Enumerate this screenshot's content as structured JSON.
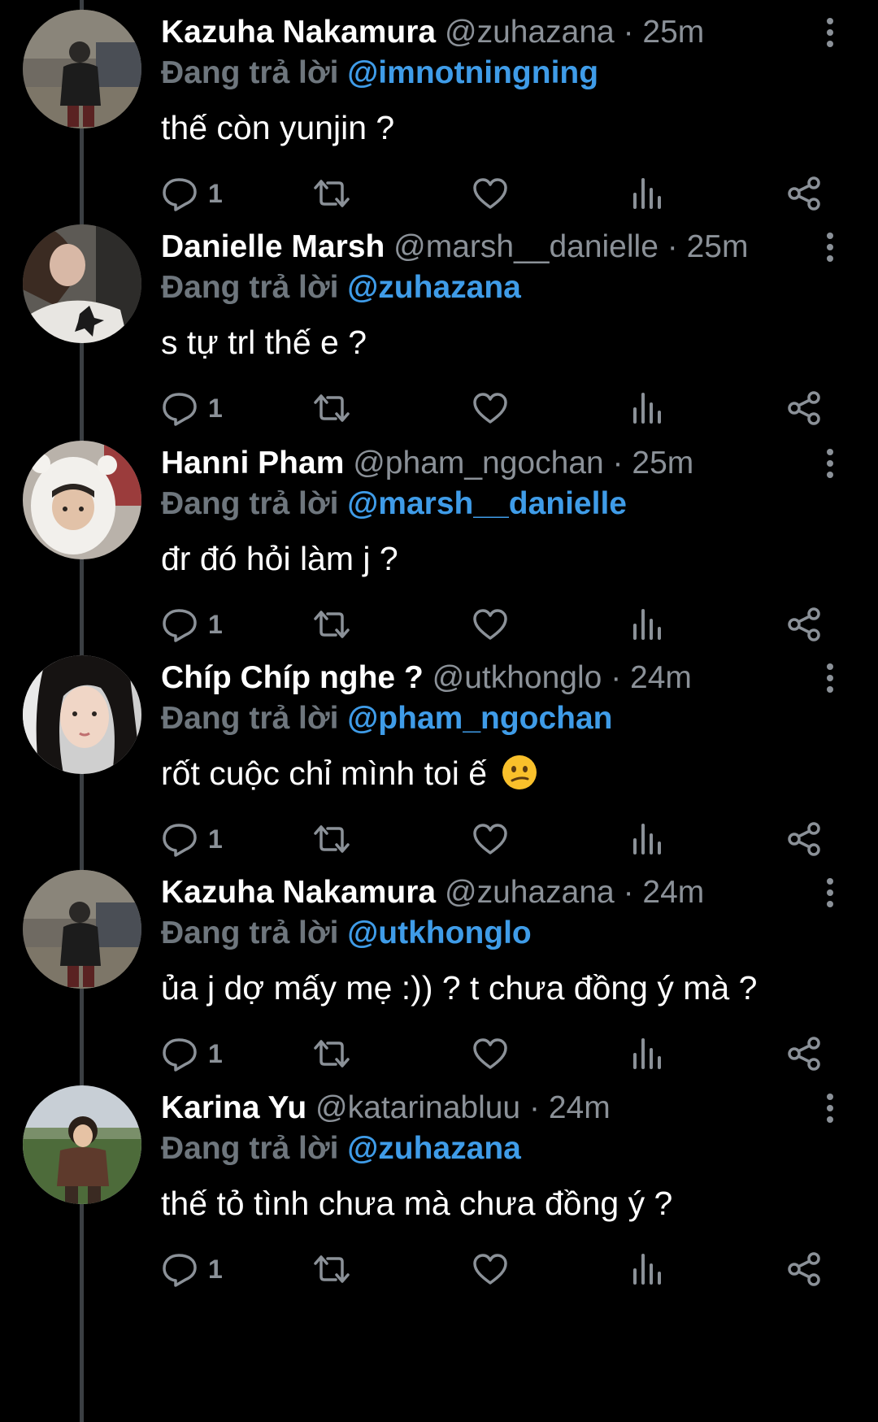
{
  "replying_label": "Đang trả lời",
  "colors": {
    "background": "#000000",
    "name": "#ffffff",
    "muted": "#8b9198",
    "mention": "#3f9ce8",
    "thread_line": "#3b3f43"
  },
  "icons": [
    "reply-icon",
    "retweet-icon",
    "like-icon",
    "views-icon",
    "share-icon",
    "more-icon"
  ],
  "tweets": [
    {
      "name": "Kazuha Nakamura",
      "handle": "@zuhazana",
      "sep": "·",
      "time": "25m",
      "mention": "@imnotningning",
      "text": "thế còn yunjin ?",
      "reply_count": "1"
    },
    {
      "name": "Danielle Marsh",
      "handle": "@marsh__danielle",
      "sep": "·",
      "time": "25m",
      "mention": "@zuhazana",
      "text": "s tự trl thế e ?",
      "reply_count": "1"
    },
    {
      "name": "Hanni Pham",
      "handle": "@pham_ngochan",
      "sep": "·",
      "time": "25m",
      "mention": "@marsh__danielle",
      "text": "đr đó hỏi làm j ?",
      "reply_count": "1"
    },
    {
      "name": "Chíp Chíp nghe ?",
      "handle": "@utkhonglo",
      "sep": "·",
      "time": "24m",
      "mention": "@pham_ngochan",
      "text": "rốt cuộc chỉ mình toi ế",
      "reply_count": "1"
    },
    {
      "name": "Kazuha Nakamura",
      "handle": "@zuhazana",
      "sep": "·",
      "time": "24m",
      "mention": "@utkhonglo",
      "text": "ủa j dợ mấy mẹ :)) ? t chưa đồng ý mà ?",
      "reply_count": "1"
    },
    {
      "name": "Karina Yu",
      "handle": "@katarinabluu",
      "sep": "·",
      "time": "24m",
      "mention": "@zuhazana",
      "text": "thế tỏ tình chưa mà chưa đồng ý ?",
      "reply_count": "1"
    }
  ]
}
